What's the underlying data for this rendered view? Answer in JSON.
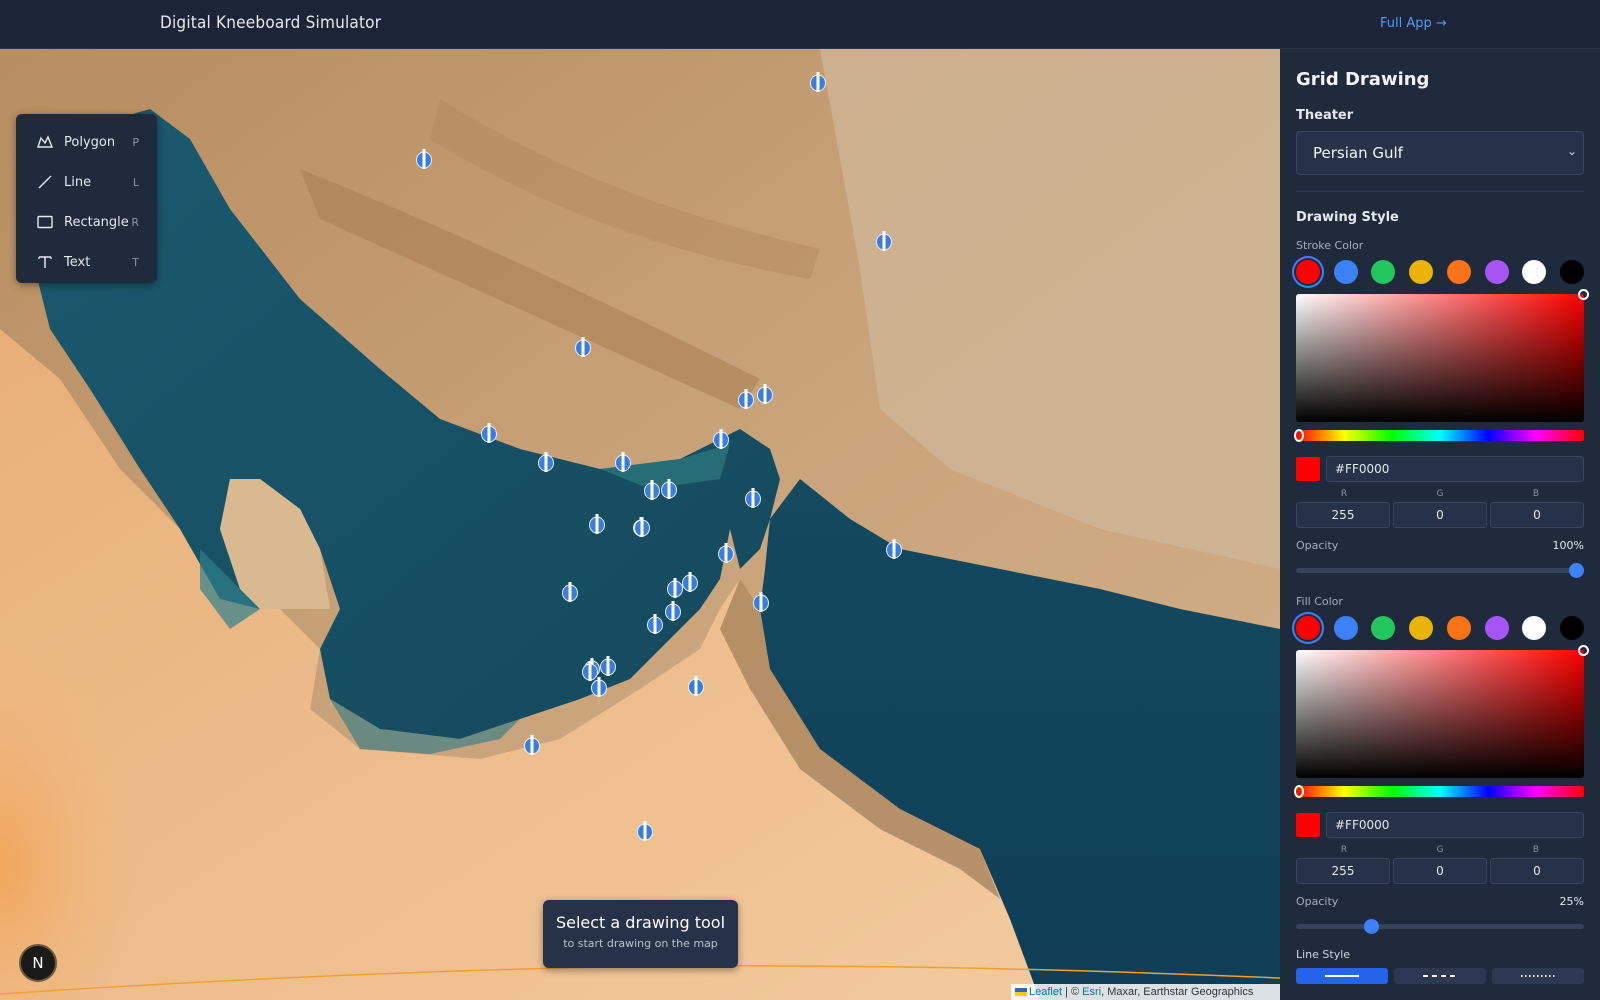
{
  "header": {
    "title": "Digital Kneeboard Simulator",
    "full_app_link": "Full App →"
  },
  "tools": [
    {
      "label": "Polygon",
      "key": "P",
      "icon": "polygon-icon"
    },
    {
      "label": "Line",
      "key": "L",
      "icon": "line-icon"
    },
    {
      "label": "Rectangle",
      "key": "R",
      "icon": "rectangle-icon"
    },
    {
      "label": "Text",
      "key": "T",
      "icon": "text-icon"
    }
  ],
  "hint": {
    "title": "Select a drawing tool",
    "subtitle": "to start drawing on the map"
  },
  "map": {
    "north_label": "N",
    "attribution_leaflet": "Leaflet",
    "attribution_sep": " | © ",
    "attribution_esri": "Esri",
    "attribution_rest": ", Maxar, Earthstar Geographics",
    "marker_count": 32
  },
  "panel": {
    "title": "Grid Drawing",
    "theater_label": "Theater",
    "theater_value": "Persian Gulf",
    "drawing_style_label": "Drawing Style",
    "swatch_colors": [
      "#ff0000",
      "#3b82f6",
      "#22c55e",
      "#eab308",
      "#f97316",
      "#a855f7",
      "#ffffff",
      "#000000"
    ],
    "stroke": {
      "label": "Stroke Color",
      "hex": "#FF0000",
      "r_label": "R",
      "g_label": "G",
      "b_label": "B",
      "r": "255",
      "g": "0",
      "b": "0",
      "opacity_label": "Opacity",
      "opacity_text": "100%",
      "opacity": 1.0
    },
    "fill": {
      "label": "Fill Color",
      "hex": "#FF0000",
      "r_label": "R",
      "g_label": "G",
      "b_label": "B",
      "r": "255",
      "g": "0",
      "b": "0",
      "opacity_label": "Opacity",
      "opacity_text": "25%",
      "opacity": 0.25
    },
    "line_style_label": "Line Style",
    "line_styles": [
      "solid",
      "dashed",
      "dotted"
    ],
    "selected_line_style": "solid"
  },
  "colors": {
    "accent": "#3b82f6",
    "link": "#4f9cf7"
  }
}
